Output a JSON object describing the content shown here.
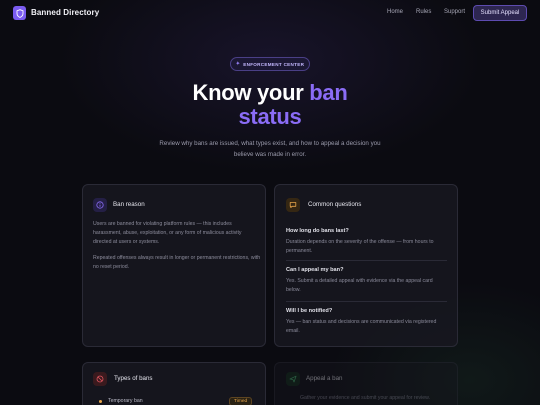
{
  "nav": {
    "brand": "Banned Directory",
    "links": [
      "Home",
      "Rules",
      "Support"
    ],
    "cta": "Submit Appeal"
  },
  "hero": {
    "pill": "ENFORCEMENT CENTER",
    "title_plain": "Know your ",
    "title_accent_1": "ban",
    "title_accent_2": "status",
    "subtitle": "Review why bans are issued, what types exist, and how to appeal a decision you believe was made in error."
  },
  "ban_reason": {
    "title": "Ban reason",
    "p1": "Users are banned for violating platform rules — this includes harassment, abuse, exploitation, or any form of malicious activity directed at users or systems.",
    "p2": "Repeated offenses always result in longer or permanent restrictions, with no reset period."
  },
  "questions": {
    "title": "Common questions",
    "items": [
      {
        "q": "How long do bans last?",
        "a": "Duration depends on the severity of the offense — from hours to permanent."
      },
      {
        "q": "Can I appeal my ban?",
        "a": "Yes. Submit a detailed appeal with evidence via the appeal card below."
      },
      {
        "q": "Will I be notified?",
        "a": "Yes — ban status and decisions are communicated via registered email."
      }
    ]
  },
  "types": {
    "title": "Types of bans",
    "first_item": "Temporary ban",
    "first_tag": "Timed"
  },
  "appeal": {
    "title": "Appeal a ban",
    "text": "Gather your evidence and submit your appeal for review."
  },
  "colors": {
    "accent": "#8a6cf5",
    "background": "#0b0b11",
    "warning": "#e8a64b"
  }
}
